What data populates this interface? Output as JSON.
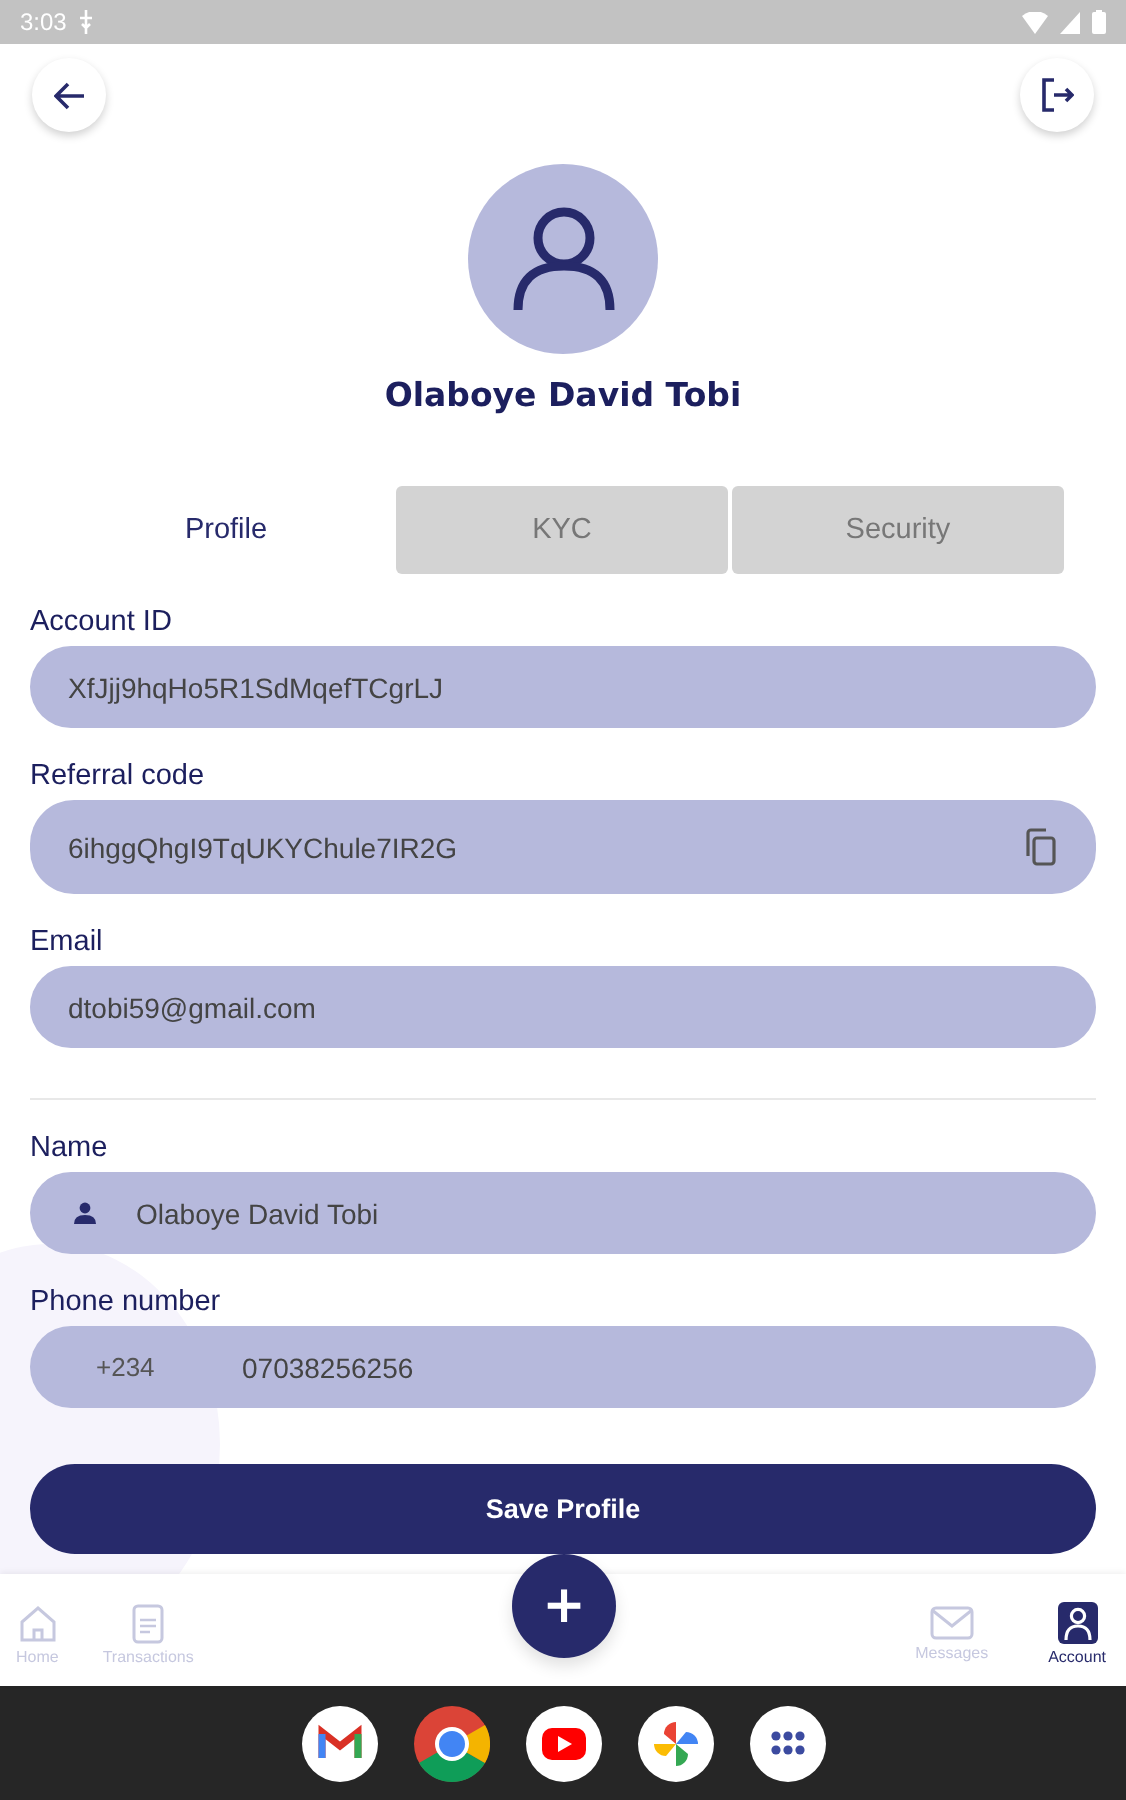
{
  "status_bar": {
    "time": "3:03"
  },
  "profile": {
    "name": "Olaboye David Tobi"
  },
  "tabs": [
    {
      "label": "Profile",
      "selected": true
    },
    {
      "label": "KYC",
      "selected": false
    },
    {
      "label": "Security",
      "selected": false
    }
  ],
  "fields": [
    {
      "kind": "plain",
      "label": "Account ID",
      "value": "XfJjj9hqHo5R1SdMqefTCgrLJ"
    },
    {
      "kind": "copy",
      "label": "Referral code",
      "value": "6ihggQhgI9TqUKYChule7IR2G"
    },
    {
      "kind": "plain",
      "label": "Email",
      "value": "dtobi59@gmail.com"
    },
    {
      "kind": "divider"
    },
    {
      "kind": "person",
      "label": "Name",
      "value": "Olaboye David Tobi"
    },
    {
      "kind": "phone",
      "label": "Phone number",
      "prefix": "+234",
      "value": "07038256256"
    }
  ],
  "save_button": {
    "label": "Save Profile"
  },
  "fab": {
    "label": "+"
  },
  "bottom_nav": [
    {
      "kind": "home",
      "label": "Home",
      "selected": false
    },
    {
      "kind": "document",
      "label": "Transactions",
      "selected": false
    },
    {
      "kind": "mail",
      "label": "Messages",
      "selected": false
    },
    {
      "kind": "account",
      "label": "Account",
      "selected": true
    }
  ]
}
